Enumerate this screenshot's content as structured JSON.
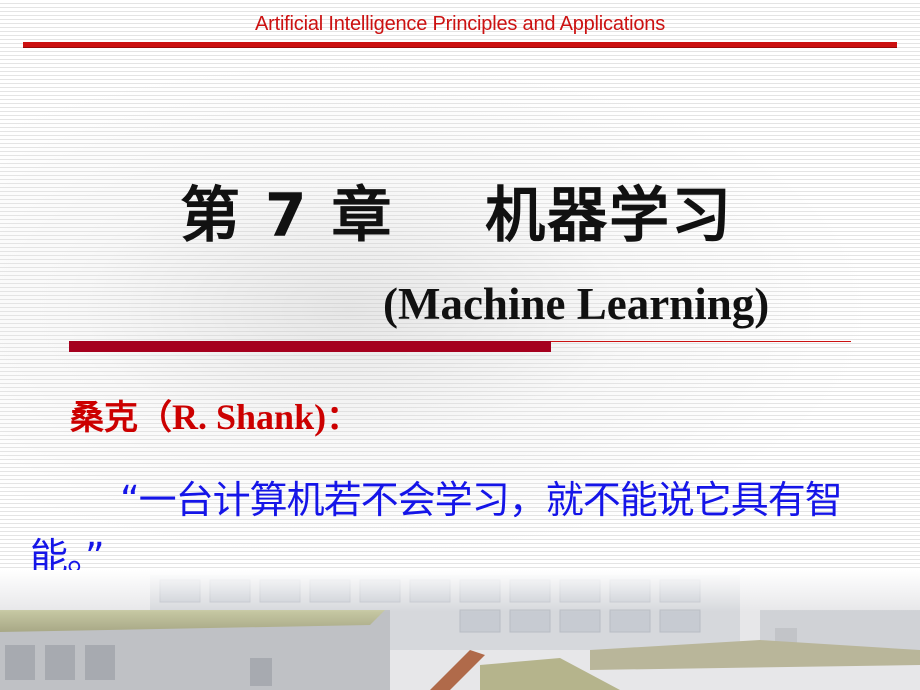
{
  "header": {
    "title": "Artificial Intelligence Principles and Applications"
  },
  "chapter": {
    "title": "第 7 章    机器学习",
    "subtitle": "(Machine Learning)"
  },
  "quote": {
    "speaker_zh": "桑克（",
    "speaker_en": "R. Shank)",
    "speaker_colon": "：",
    "text": "“一台计算机若不会学习，就不能说它具有智能。”"
  },
  "background": {
    "image": "campus-buildings-photo"
  },
  "colors": {
    "header_red": "#cc1111",
    "rule_dark_red": "#a5001e",
    "speaker_red": "#cc0000",
    "quote_blue": "#1515e8",
    "title_black": "#111111"
  }
}
